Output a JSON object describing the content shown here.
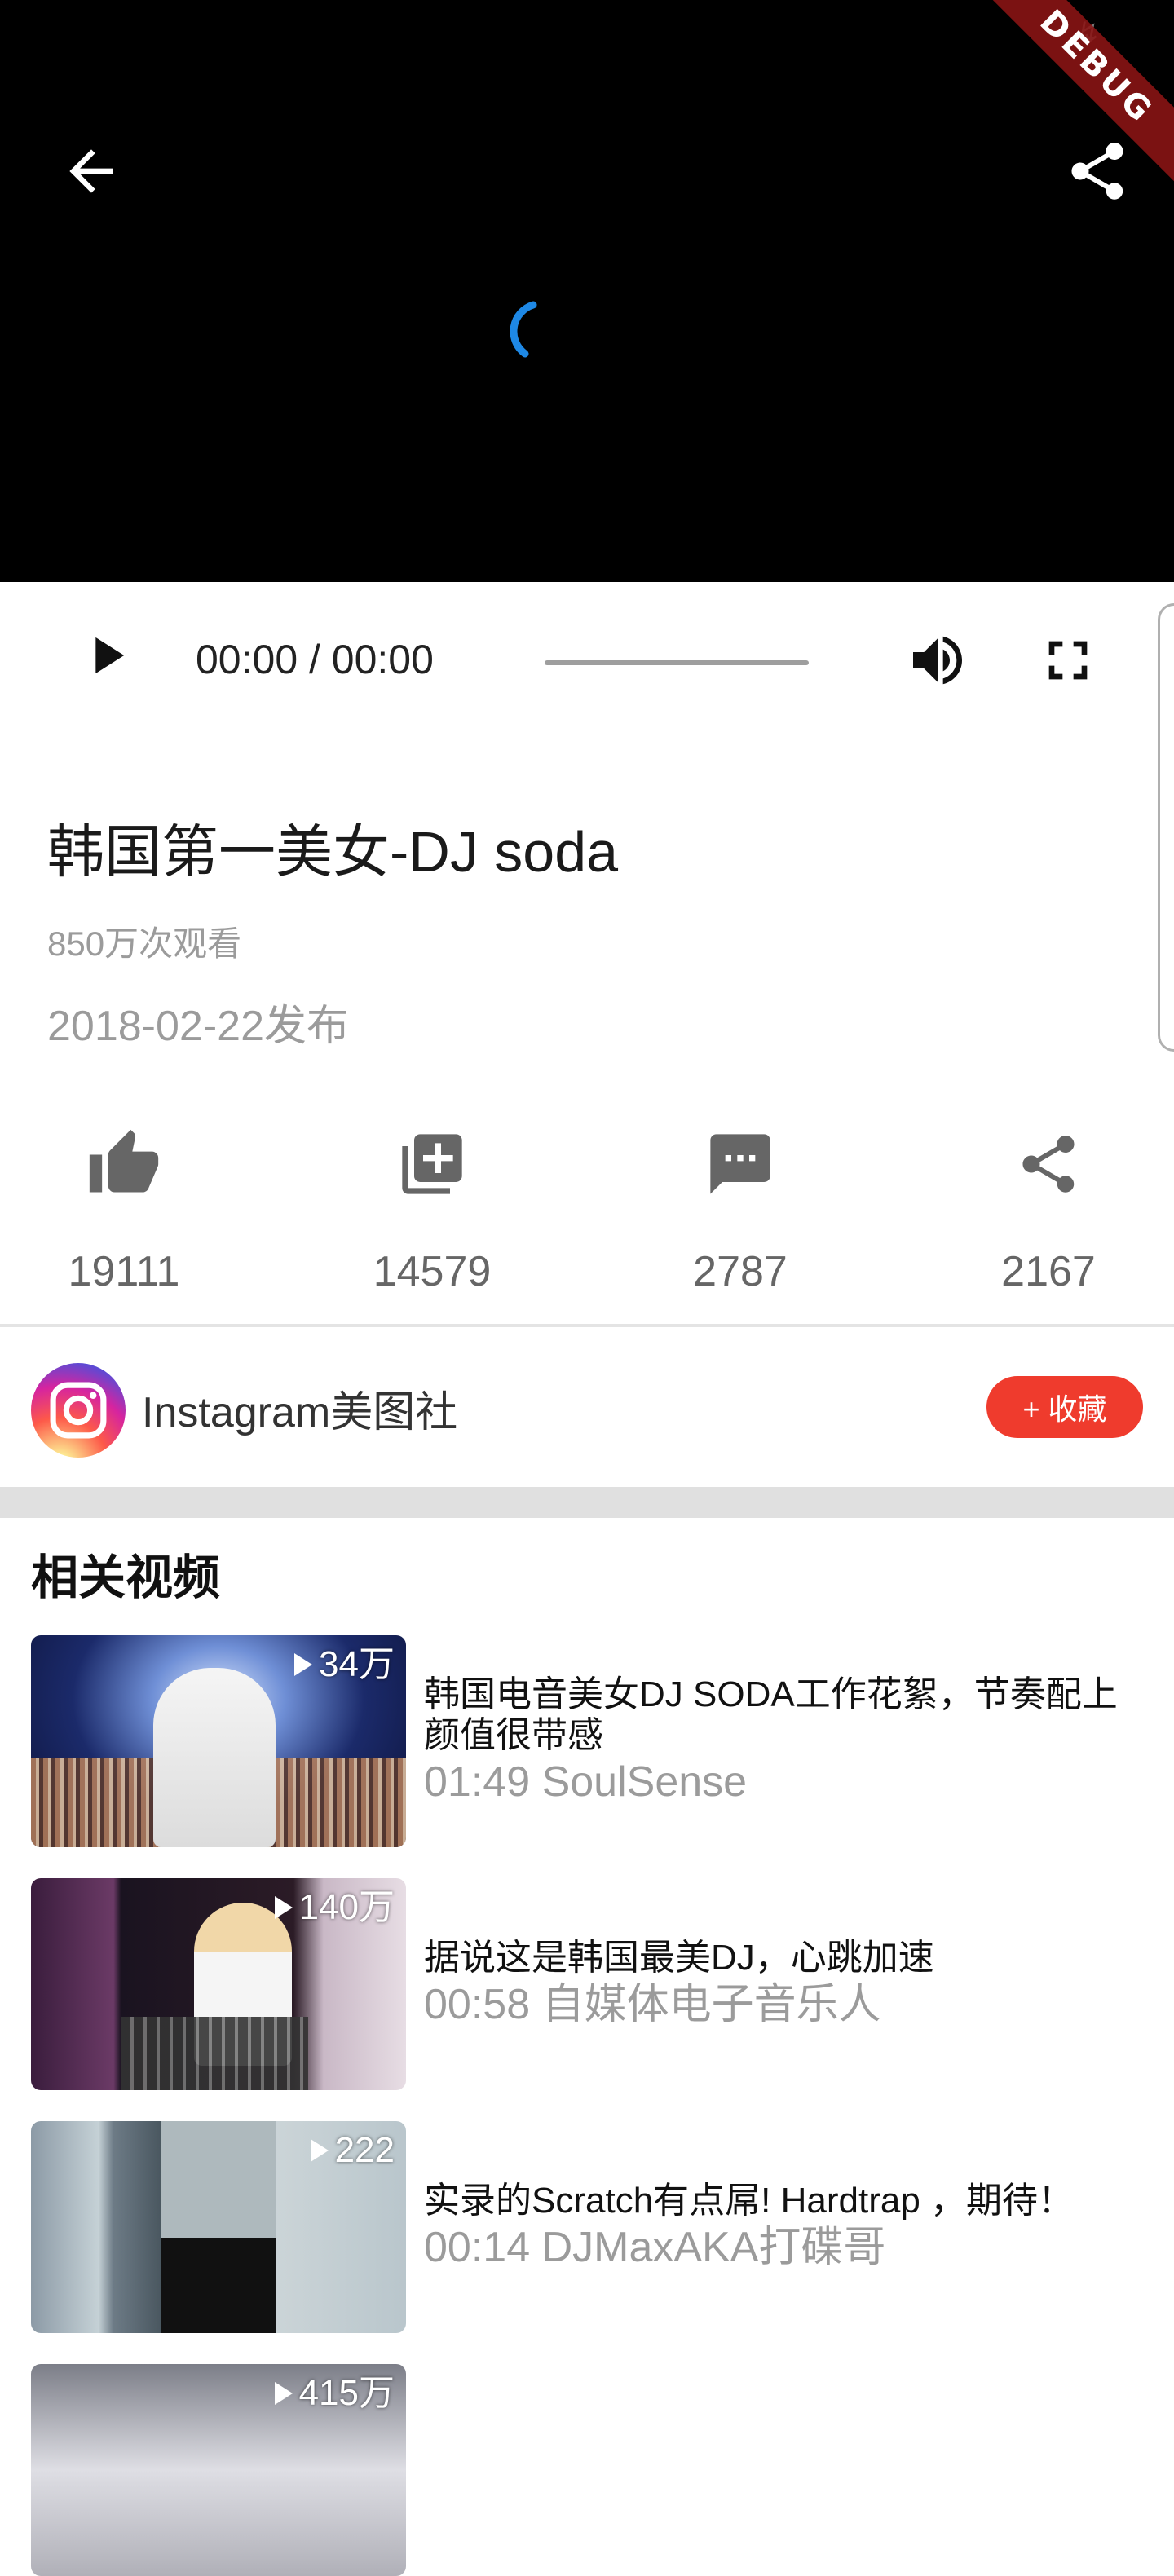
{
  "status": {
    "icons": "↯"
  },
  "debug_banner": "DEBUG",
  "player": {
    "time": "00:00 / 00:00",
    "progress": 0.0,
    "accent_color": "#1e88e5"
  },
  "video": {
    "title": "韩国第一美女-DJ soda",
    "views": "850万次观看",
    "publish_date": "2018-02-22发布"
  },
  "actions": [
    {
      "icon": "thumb-up-icon",
      "count": "19111"
    },
    {
      "icon": "add-to-library-icon",
      "count": "14579"
    },
    {
      "icon": "comment-icon",
      "count": "2787"
    },
    {
      "icon": "share-icon",
      "count": "2167"
    }
  ],
  "channel": {
    "name": "Instagram美图社",
    "follow_label": "+ 收藏",
    "follow_color": "#ef3b2d"
  },
  "related": {
    "heading": "相关视频",
    "items": [
      {
        "count": "34万",
        "title": "韩国电音美女DJ SODA工作花絮，节奏配上颜值很带感",
        "meta": "01:49 SoulSense"
      },
      {
        "count": "140万",
        "title": "据说这是韩国最美DJ，心跳加速",
        "meta": "00:58 自媒体电子音乐人"
      },
      {
        "count": "222",
        "title": "实录的Scratch有点屌! Hardtrap ，期待！",
        "meta": "00:14 DJMaxAKA打碟哥"
      },
      {
        "count": "415万",
        "title": "",
        "meta": ""
      }
    ]
  }
}
